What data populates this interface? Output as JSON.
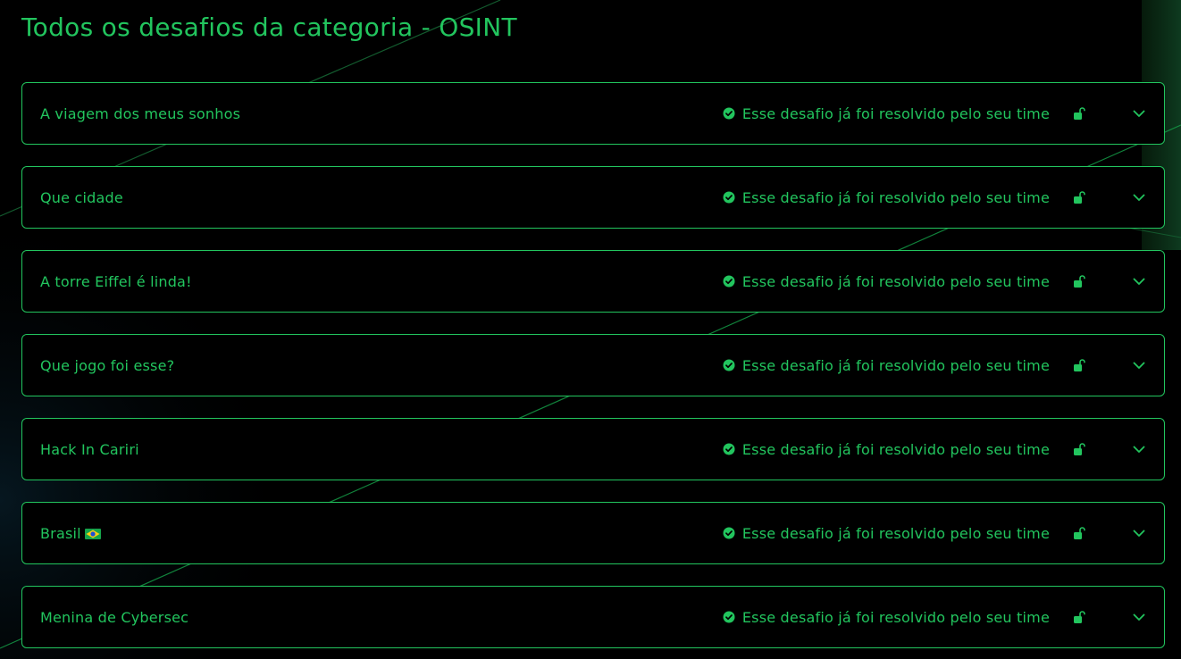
{
  "page": {
    "title": "Todos os desafios da categoria - OSINT"
  },
  "challenges": [
    {
      "title": "A viagem dos meus sonhos",
      "status": "Esse desafio já foi resolvido pelo seu time",
      "flag": ""
    },
    {
      "title": "Que cidade",
      "status": "Esse desafio já foi resolvido pelo seu time",
      "flag": ""
    },
    {
      "title": "A torre Eiffel é linda!",
      "status": "Esse desafio já foi resolvido pelo seu time",
      "flag": ""
    },
    {
      "title": "Que jogo foi esse?",
      "status": "Esse desafio já foi resolvido pelo seu time",
      "flag": ""
    },
    {
      "title": "Hack In Cariri",
      "status": "Esse desafio já foi resolvido pelo seu time",
      "flag": ""
    },
    {
      "title": "Brasil",
      "status": "Esse desafio já foi resolvido pelo seu time",
      "flag": "brazil-flag-icon"
    },
    {
      "title": "Menina de Cybersec",
      "status": "Esse desafio já foi resolvido pelo seu time",
      "flag": ""
    }
  ],
  "icons": {
    "status": "check-circle-icon",
    "lock": "unlocked-icon",
    "expand": "chevron-down-icon"
  },
  "colors": {
    "accent": "#22c55e",
    "background": "#000000"
  }
}
